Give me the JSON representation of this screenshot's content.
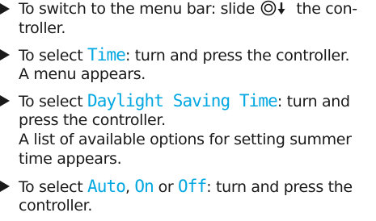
{
  "steps": [
    {
      "lines": [
        {
          "t1": "To switch to the menu bar: slide ",
          "t2": " the con-"
        },
        {
          "t1": "troller."
        }
      ]
    },
    {
      "lines": [
        {
          "t1": "To select ",
          "hl": "Time",
          "t2": ": turn and press the controller."
        },
        {
          "t1": "A menu appears."
        }
      ]
    },
    {
      "lines": [
        {
          "t1": "To select ",
          "hl": "Daylight Saving Time",
          "t2": ": turn and"
        },
        {
          "t1": "press the controller."
        },
        {
          "t1": "A list of available options for setting summer"
        },
        {
          "t1": "time appears."
        }
      ]
    },
    {
      "lines": [
        {
          "t1": "To select ",
          "hl1": "Auto",
          "sep1": ", ",
          "hl2": "On",
          "sep2": " or ",
          "hl3": "Off",
          "t2": ": turn and press the"
        },
        {
          "t1": "controller."
        }
      ]
    }
  ],
  "icons": {
    "bullet": "right-triangle-bullet-icon",
    "controller": "controller-slide-down-icon"
  },
  "colors": {
    "highlight": "#00a7e0",
    "text": "#1a1a1a"
  }
}
